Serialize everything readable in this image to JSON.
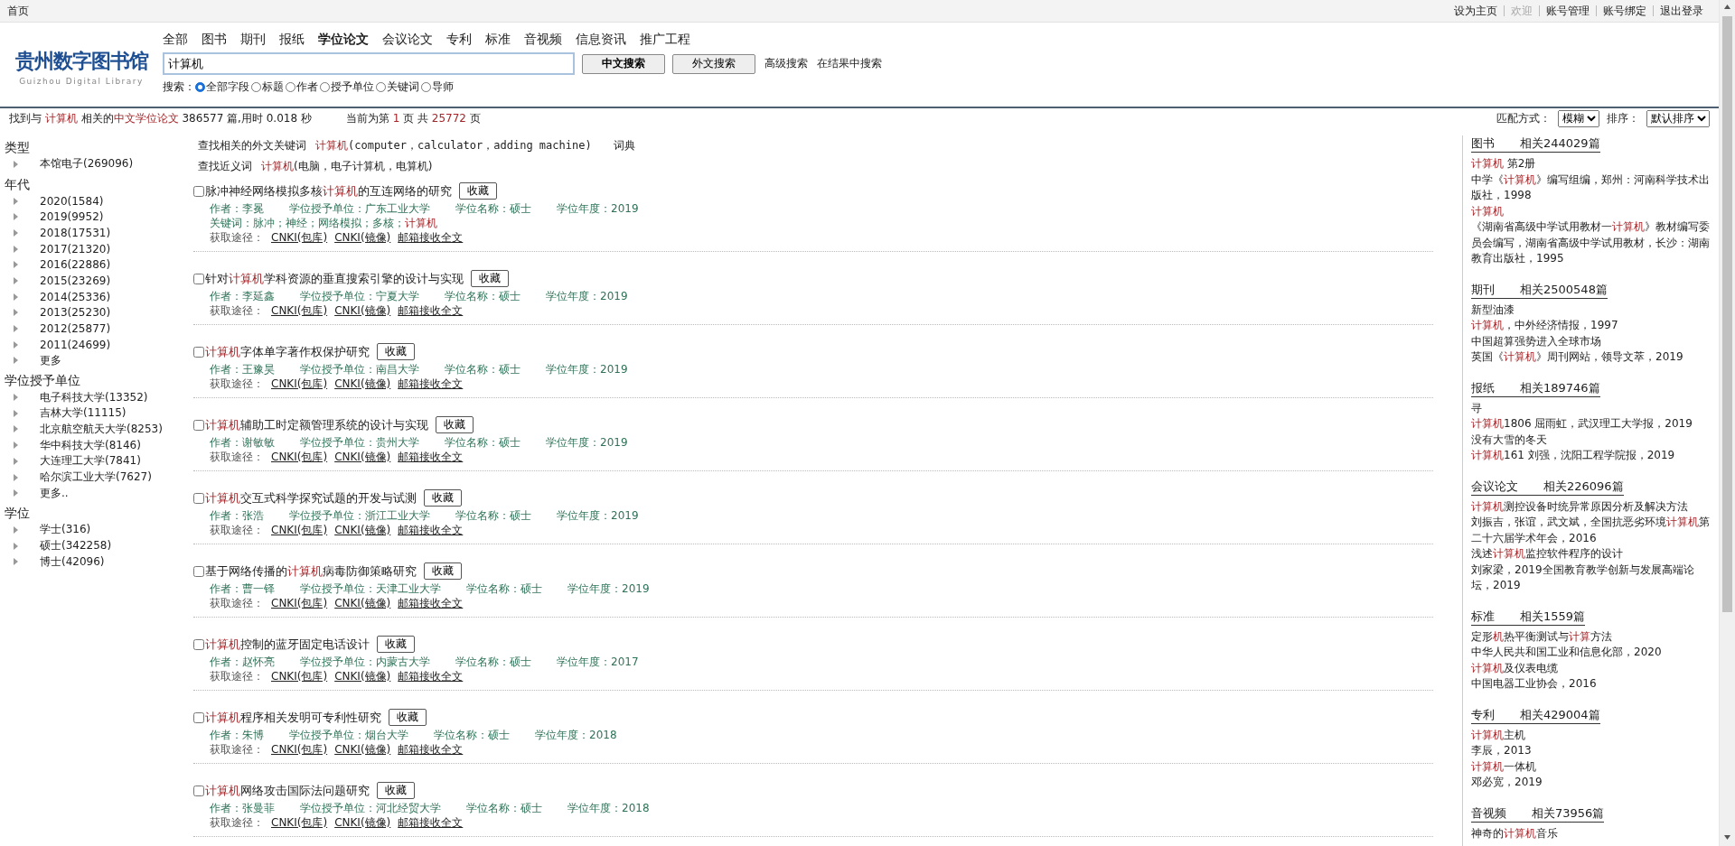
{
  "top_bar": {
    "home": "首页",
    "links": [
      {
        "label": "设为主页",
        "muted": false
      },
      {
        "label": "欢迎",
        "muted": true
      },
      {
        "label": "账号管理",
        "muted": false
      },
      {
        "label": "账号绑定",
        "muted": false
      },
      {
        "label": "退出登录",
        "muted": false
      }
    ]
  },
  "logo": {
    "title": "贵州数字图书馆",
    "subtitle": "Guizhou Digital Library"
  },
  "nav": [
    {
      "label": "全部",
      "selected": false
    },
    {
      "label": "图书",
      "selected": false
    },
    {
      "label": "期刊",
      "selected": false
    },
    {
      "label": "报纸",
      "selected": false
    },
    {
      "label": "学位论文",
      "selected": true
    },
    {
      "label": "会议论文",
      "selected": false
    },
    {
      "label": "专利",
      "selected": false
    },
    {
      "label": "标准",
      "selected": false
    },
    {
      "label": "音视频",
      "selected": false
    },
    {
      "label": "信息资讯",
      "selected": false
    },
    {
      "label": "推广工程",
      "selected": false
    }
  ],
  "search": {
    "value": "计算机",
    "buttons": [
      {
        "label": "中文搜索",
        "primary": true
      },
      {
        "label": "外文搜索",
        "primary": false
      }
    ],
    "links": [
      "高级搜索",
      "在结果中搜索"
    ],
    "field_label": "搜索：",
    "fields": [
      {
        "label": "全部字段",
        "selected": true
      },
      {
        "label": "标题",
        "selected": false
      },
      {
        "label": "作者",
        "selected": false
      },
      {
        "label": "授予单位",
        "selected": false
      },
      {
        "label": "关键词",
        "selected": false
      },
      {
        "label": "导师",
        "selected": false
      }
    ]
  },
  "summary": [
    {
      "text": "找到与 ",
      "highlight": false
    },
    {
      "text": "计算机",
      "highlight": true
    },
    {
      "text": " 相关的",
      "highlight": false
    },
    {
      "text": "中文学位论文",
      "highlight": true
    },
    {
      "text": " 386577 篇,用时 0.018 秒",
      "highlight": false
    }
  ],
  "paging": [
    {
      "text": "当前为第 ",
      "highlight": false
    },
    {
      "text": "1",
      "highlight": true
    },
    {
      "text": " 页 共 ",
      "highlight": false
    },
    {
      "text": "25772",
      "highlight": true
    },
    {
      "text": " 页",
      "highlight": false
    }
  ],
  "match": {
    "label": "匹配方式：",
    "value": "模糊"
  },
  "sort": {
    "label": "排序：",
    "value": "默认排序"
  },
  "facets": [
    {
      "title": "类型",
      "items": [
        "本馆电子(269096)"
      ]
    },
    {
      "title": "年代",
      "items": [
        "2020(1584)",
        "2019(9952)",
        "2018(17531)",
        "2017(21320)",
        "2016(22886)",
        "2015(23269)",
        "2014(25336)",
        "2013(25230)",
        "2012(25877)",
        "2011(24699)",
        "更多"
      ]
    },
    {
      "title": "学位授予单位",
      "items": [
        "电子科技大学(13352)",
        "吉林大学(11115)",
        "北京航空航天大学(8253)",
        "华中科技大学(8146)",
        "大连理工大学(7841)",
        "哈尔滨工业大学(7627)",
        "更多.."
      ]
    },
    {
      "title": "学位",
      "items": [
        "学士(316)",
        "硕士(342258)",
        "博士(42096)"
      ]
    }
  ],
  "suggestions": [
    {
      "label": "查找相关的外文关键词",
      "keyword": "计算机",
      "detail": "(computer，calculator，adding machine)",
      "link": "词典"
    },
    {
      "label": "查找近义词",
      "keyword": "计算机",
      "detail": "(电脑，电子计算机，电算机)"
    }
  ],
  "results": [
    {
      "checked": false,
      "title": [
        {
          "text": "脉冲神经网络模拟多核",
          "highlight": false
        },
        {
          "text": "计算机",
          "highlight": true
        },
        {
          "text": "的互连网络的研究",
          "highlight": false
        }
      ],
      "collect": "收藏",
      "meta": [
        "作者：李冕",
        "学位授予单位：广东工业大学",
        "学位名称：硕士",
        "学位年度：2019"
      ],
      "keywords": [
        {
          "text": "关键词：脉冲；神经；网络模拟；多核；",
          "highlight": false
        },
        {
          "text": "计算机",
          "highlight": true
        }
      ],
      "access": "获取途径：",
      "links": [
        "CNKI(包库)",
        "CNKI(镜像)",
        "邮箱接收全文"
      ]
    },
    {
      "checked": false,
      "title": [
        {
          "text": "针对",
          "highlight": false
        },
        {
          "text": "计算机",
          "highlight": true
        },
        {
          "text": "学科资源的垂直搜索引擎的设计与实现",
          "highlight": false
        }
      ],
      "collect": "收藏",
      "meta": [
        "作者：李延鑫",
        "学位授予单位：宁夏大学",
        "学位名称：硕士",
        "学位年度：2019"
      ],
      "access": "获取途径：",
      "links": [
        "CNKI(包库)",
        "CNKI(镜像)",
        "邮箱接收全文"
      ]
    },
    {
      "checked": false,
      "title": [
        {
          "text": "计算机",
          "highlight": true
        },
        {
          "text": "字体单字著作权保护研究",
          "highlight": false
        }
      ],
      "collect": "收藏",
      "meta": [
        "作者：王豫昊",
        "学位授予单位：南昌大学",
        "学位名称：硕士",
        "学位年度：2019"
      ],
      "access": "获取途径：",
      "links": [
        "CNKI(包库)",
        "CNKI(镜像)",
        "邮箱接收全文"
      ]
    },
    {
      "checked": false,
      "title": [
        {
          "text": "计算机",
          "highlight": true
        },
        {
          "text": "辅助工时定额管理系统的设计与实现",
          "highlight": false
        }
      ],
      "collect": "收藏",
      "meta": [
        "作者：谢敏敏",
        "学位授予单位：贵州大学",
        "学位名称：硕士",
        "学位年度：2019"
      ],
      "access": "获取途径：",
      "links": [
        "CNKI(包库)",
        "CNKI(镜像)",
        "邮箱接收全文"
      ]
    },
    {
      "checked": false,
      "title": [
        {
          "text": "计算机",
          "highlight": true
        },
        {
          "text": "交互式科学探究试题的开发与试测",
          "highlight": false
        }
      ],
      "collect": "收藏",
      "meta": [
        "作者：张浩",
        "学位授予单位：浙江工业大学",
        "学位名称：硕士",
        "学位年度：2019"
      ],
      "access": "获取途径：",
      "links": [
        "CNKI(包库)",
        "CNKI(镜像)",
        "邮箱接收全文"
      ]
    },
    {
      "checked": false,
      "title": [
        {
          "text": "基于网络传播的",
          "highlight": false
        },
        {
          "text": "计算机",
          "highlight": true
        },
        {
          "text": "病毒防御策略研究",
          "highlight": false
        }
      ],
      "collect": "收藏",
      "meta": [
        "作者：曹一铎",
        "学位授予单位：天津工业大学",
        "学位名称：硕士",
        "学位年度：2019"
      ],
      "access": "获取途径：",
      "links": [
        "CNKI(包库)",
        "CNKI(镜像)",
        "邮箱接收全文"
      ]
    },
    {
      "checked": false,
      "title": [
        {
          "text": "计算机",
          "highlight": true
        },
        {
          "text": "控制的蓝牙固定电话设计",
          "highlight": false
        }
      ],
      "collect": "收藏",
      "meta": [
        "作者：赵怀亮",
        "学位授予单位：内蒙古大学",
        "学位名称：硕士",
        "学位年度：2017"
      ],
      "access": "获取途径：",
      "links": [
        "CNKI(包库)",
        "CNKI(镜像)",
        "邮箱接收全文"
      ]
    },
    {
      "checked": false,
      "title": [
        {
          "text": "计算机",
          "highlight": true
        },
        {
          "text": "程序相关发明可专利性研究",
          "highlight": false
        }
      ],
      "collect": "收藏",
      "meta": [
        "作者：朱博",
        "学位授予单位：烟台大学",
        "学位名称：硕士",
        "学位年度：2018"
      ],
      "access": "获取途径：",
      "links": [
        "CNKI(包库)",
        "CNKI(镜像)",
        "邮箱接收全文"
      ]
    },
    {
      "checked": false,
      "title": [
        {
          "text": "计算机",
          "highlight": true
        },
        {
          "text": "网络攻击国际法问题研究",
          "highlight": false
        }
      ],
      "collect": "收藏",
      "meta": [
        "作者：张曼菲",
        "学位授予单位：河北经贸大学",
        "学位名称：硕士",
        "学位年度：2018"
      ],
      "access": "获取途径：",
      "links": [
        "CNKI(包库)",
        "CNKI(镜像)",
        "邮箱接收全文"
      ]
    }
  ],
  "related": [
    {
      "title": "图书",
      "count": "相关244029篇",
      "entries": [
        [
          {
            "text": "计算机",
            "highlight": true
          },
          {
            "text": " 第2册",
            "highlight": false
          }
        ],
        [
          {
            "text": "中学《",
            "highlight": false
          },
          {
            "text": "计算机",
            "highlight": true
          },
          {
            "text": "》编写组编，郑州：河南科学技术出版社，1998",
            "highlight": false
          }
        ],
        [
          {
            "text": "计算机",
            "highlight": true
          }
        ],
        [
          {
            "text": "《湖南省高级中学试用教材一",
            "highlight": false
          },
          {
            "text": "计算机",
            "highlight": true
          },
          {
            "text": "》教材编写委员会编写，湖南省高级中学试用教材，长沙：湖南教育出版社，1995",
            "highlight": false
          }
        ]
      ]
    },
    {
      "title": "期刊",
      "count": "相关2500548篇",
      "entries": [
        [
          {
            "text": "新型油漆",
            "highlight": false
          }
        ],
        [
          {
            "text": "计算机",
            "highlight": true
          },
          {
            "text": "，中外经济情报，1997",
            "highlight": false
          }
        ],
        [
          {
            "text": "中国超算强势进入全球市场",
            "highlight": false
          }
        ],
        [
          {
            "text": "英国《",
            "highlight": false
          },
          {
            "text": "计算机",
            "highlight": true
          },
          {
            "text": "》周刊网站，领导文萃，2019",
            "highlight": false
          }
        ]
      ]
    },
    {
      "title": "报纸",
      "count": "相关189746篇",
      "entries": [
        [
          {
            "text": "寻",
            "highlight": false
          }
        ],
        [
          {
            "text": "计算机",
            "highlight": true
          },
          {
            "text": "1806 屈雨虹，武汉理工大学报，2019",
            "highlight": false
          }
        ],
        [
          {
            "text": "没有大雪的冬天",
            "highlight": false
          }
        ],
        [
          {
            "text": "计算机",
            "highlight": true
          },
          {
            "text": "161 刘强，沈阳工程学院报，2019",
            "highlight": false
          }
        ]
      ]
    },
    {
      "title": "会议论文",
      "count": "相关226096篇",
      "entries": [
        [
          {
            "text": "计算机",
            "highlight": true
          },
          {
            "text": "测控设备时统异常原因分析及解决方法",
            "highlight": false
          }
        ],
        [
          {
            "text": "刘振吉，张谊，武文斌，全国抗恶劣环境",
            "highlight": false
          },
          {
            "text": "计算机",
            "highlight": true
          },
          {
            "text": "第二十六届学术年会，2016",
            "highlight": false
          }
        ],
        [
          {
            "text": "浅述",
            "highlight": false
          },
          {
            "text": "计算机",
            "highlight": true
          },
          {
            "text": "监控软件程序的设计",
            "highlight": false
          }
        ],
        [
          {
            "text": "刘家梁，2019全国教育教学创新与发展高端论坛，2019",
            "highlight": false
          }
        ]
      ]
    },
    {
      "title": "标准",
      "count": "相关1559篇",
      "entries": [
        [
          {
            "text": "定形",
            "highlight": false
          },
          {
            "text": "机",
            "highlight": true
          },
          {
            "text": "热平衡测试与",
            "highlight": false
          },
          {
            "text": "计算",
            "highlight": true
          },
          {
            "text": "方法",
            "highlight": false
          }
        ],
        [
          {
            "text": "中华人民共和国工业和信息化部，2020",
            "highlight": false
          }
        ],
        [
          {
            "text": "计算机",
            "highlight": true
          },
          {
            "text": "及仪表电缆",
            "highlight": false
          }
        ],
        [
          {
            "text": "中国电器工业协会，2016",
            "highlight": false
          }
        ]
      ]
    },
    {
      "title": "专利",
      "count": "相关429004篇",
      "entries": [
        [
          {
            "text": "计算机",
            "highlight": true
          },
          {
            "text": "主机",
            "highlight": false
          }
        ],
        [
          {
            "text": "李辰，2013",
            "highlight": false
          }
        ],
        [
          {
            "text": "计算机",
            "highlight": true
          },
          {
            "text": "一体机",
            "highlight": false
          }
        ],
        [
          {
            "text": "邓必宽，2019",
            "highlight": false
          }
        ]
      ]
    },
    {
      "title": "音视频",
      "count": "相关73956篇",
      "entries": [
        [
          {
            "text": "神奇的",
            "highlight": false
          },
          {
            "text": "计算机",
            "highlight": true
          },
          {
            "text": "音乐",
            "highlight": false
          }
        ]
      ]
    }
  ]
}
